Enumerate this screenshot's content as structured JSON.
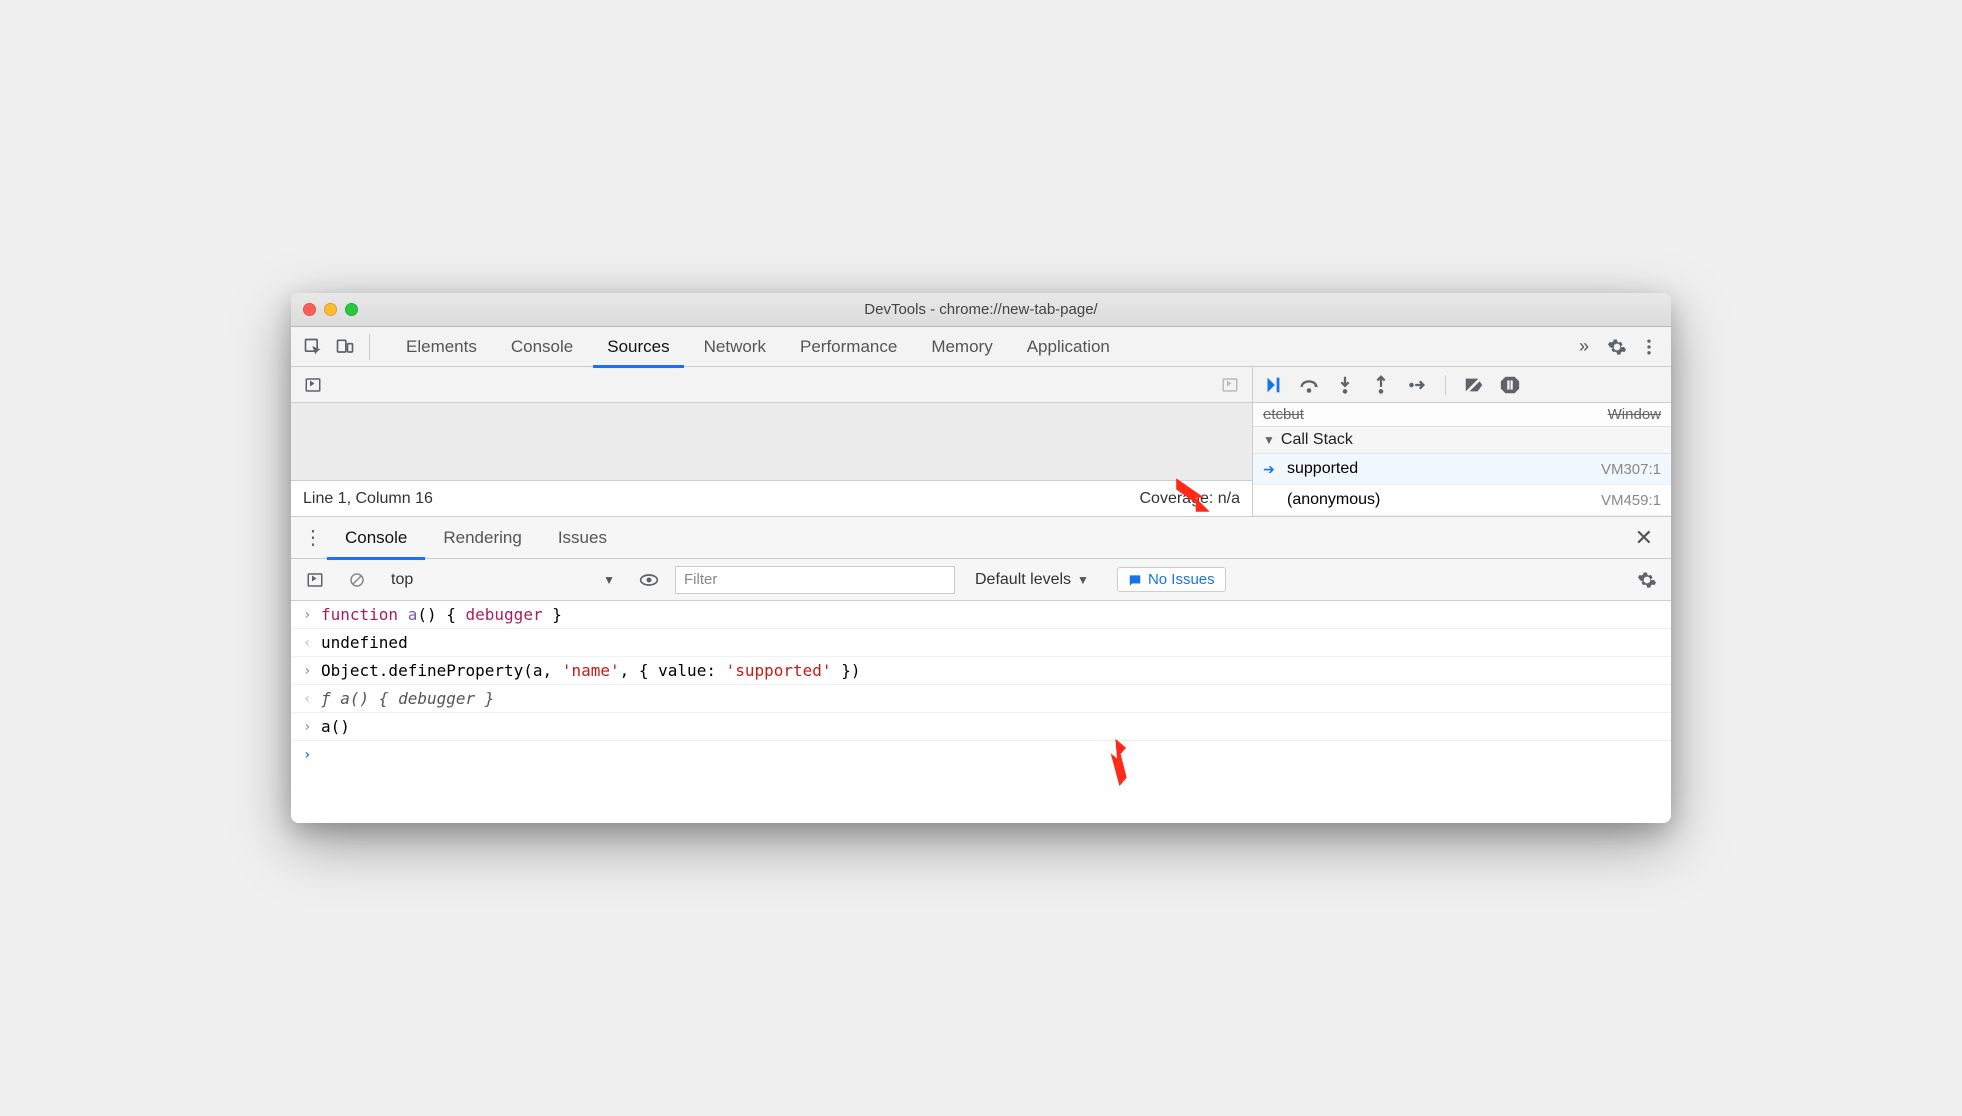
{
  "window": {
    "title": "DevTools - chrome://new-tab-page/"
  },
  "tabs": {
    "items": [
      "Elements",
      "Console",
      "Sources",
      "Network",
      "Performance",
      "Memory",
      "Application"
    ],
    "active_index": 2
  },
  "status": {
    "line_col": "Line 1, Column 16",
    "coverage": "Coverage: n/a"
  },
  "callstack": {
    "header": "Call Stack",
    "items": [
      {
        "name": "supported",
        "source": "VM307:1",
        "current": true
      },
      {
        "name": "(anonymous)",
        "source": "VM459:1",
        "current": false
      }
    ]
  },
  "drawer": {
    "tabs": [
      "Console",
      "Rendering",
      "Issues"
    ],
    "active_index": 0
  },
  "console_toolbar": {
    "context": "top",
    "filter_placeholder": "Filter",
    "levels": "Default levels",
    "issues": "No Issues"
  },
  "console_rows": [
    {
      "type": "input",
      "segments": [
        {
          "text": "function",
          "cls": "kw"
        },
        {
          "text": " "
        },
        {
          "text": "a",
          "cls": "fn"
        },
        {
          "text": "() { "
        },
        {
          "text": "debugger",
          "cls": "kw"
        },
        {
          "text": " }"
        }
      ]
    },
    {
      "type": "output",
      "segments": [
        {
          "text": "undefined",
          "cls": ""
        }
      ]
    },
    {
      "type": "input",
      "segments": [
        {
          "text": "Object.defineProperty(a, "
        },
        {
          "text": "'name'",
          "cls": "str"
        },
        {
          "text": ", { value: "
        },
        {
          "text": "'supported'",
          "cls": "str"
        },
        {
          "text": " })"
        }
      ]
    },
    {
      "type": "output",
      "segments": [
        {
          "text": "ƒ a() { debugger }",
          "cls": "ital"
        }
      ]
    },
    {
      "type": "input",
      "segments": [
        {
          "text": "a()"
        }
      ]
    }
  ]
}
